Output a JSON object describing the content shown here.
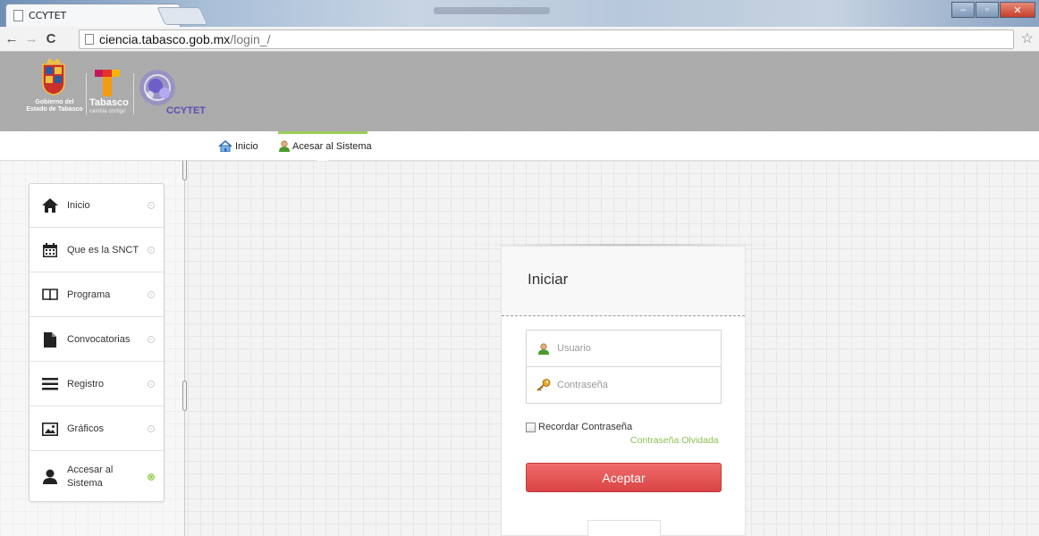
{
  "browser": {
    "tab_title": "CCYTET",
    "tab_close": "×",
    "url_host": "ciencia.tabasco.gob.mx",
    "url_path": "/login_/",
    "back_glyph": "←",
    "forward_glyph": "→",
    "reload_glyph": "C",
    "star_glyph": "☆",
    "minimize_glyph": "–",
    "maximize_glyph": "▫",
    "close_glyph": "✕"
  },
  "header": {
    "gov_text": "Gobierno del Estado de Tabasco",
    "tabasco_text": "Tabasco",
    "tabasco_sub": "cambia contigo",
    "ccytet_text": "CCYTET"
  },
  "topnav": {
    "items": [
      {
        "label": "Inicio",
        "icon": "home-icon"
      },
      {
        "label": "Acesar al Sistema",
        "icon": "user-icon"
      }
    ],
    "accent_color": "#9acd5a"
  },
  "sidebar": {
    "items": [
      {
        "label": "Inicio",
        "icon": "home-icon",
        "active": false
      },
      {
        "label": "Que es la SNCT",
        "icon": "calendar-icon",
        "active": false
      },
      {
        "label": "Programa",
        "icon": "book-icon",
        "active": false
      },
      {
        "label": "Convocatorias",
        "icon": "document-icon",
        "active": false
      },
      {
        "label": "Registro",
        "icon": "list-icon",
        "active": false
      },
      {
        "label": "Gráficos",
        "icon": "image-icon",
        "active": false
      },
      {
        "label": "Accesar al Sistema",
        "icon": "user-icon",
        "active": true
      }
    ]
  },
  "login": {
    "title": "Iniciar",
    "username_placeholder": "Usuario",
    "password_placeholder": "Contraseña",
    "remember_label": "Recordar Contraseña",
    "forgot_link": "Contraseña Olvidada",
    "submit_label": "Aceptar",
    "submit_color": "#e05353",
    "link_color": "#8cc152"
  }
}
